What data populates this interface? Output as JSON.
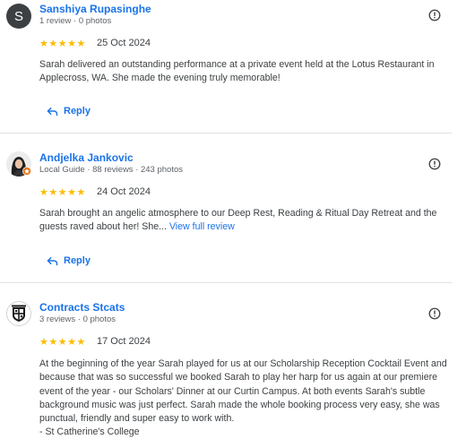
{
  "reviews": [
    {
      "avatar_letter": "S",
      "name": "Sanshiya Rupasinghe",
      "meta": "1 review · 0 photos",
      "stars": "★★★★★",
      "date": "25 Oct 2024",
      "text": "Sarah delivered an outstanding performance at a private event held at the Lotus Restaurant in Applecross, WA. She made the evening truly memorable!",
      "reply_label": "Reply"
    },
    {
      "name": "Andjelka Jankovic",
      "meta": "Local Guide · 88 reviews · 243 photos",
      "stars": "★★★★★",
      "date": "24 Oct 2024",
      "text": "Sarah brought an angelic atmosphere to our Deep Rest, Reading & Ritual Day Retreat and the guests raved about her! She...",
      "more_label": "View full review",
      "reply_label": "Reply"
    },
    {
      "name": "Contracts Stcats",
      "meta": "3 reviews · 0 photos",
      "stars": "★★★★★",
      "date": "17 Oct 2024",
      "text": "At the beginning of the year Sarah played for us at our Scholarship Reception Cocktail Event and because that was so successful we booked Sarah to play her harp for us again at our premiere event of the year - our Scholars' Dinner at our Curtin Campus. At both events Sarah's subtle background music was just perfect. Sarah made the whole booking process very easy, she was punctual, friendly and super easy to work with.",
      "signature": "- St Catherine's College"
    }
  ]
}
